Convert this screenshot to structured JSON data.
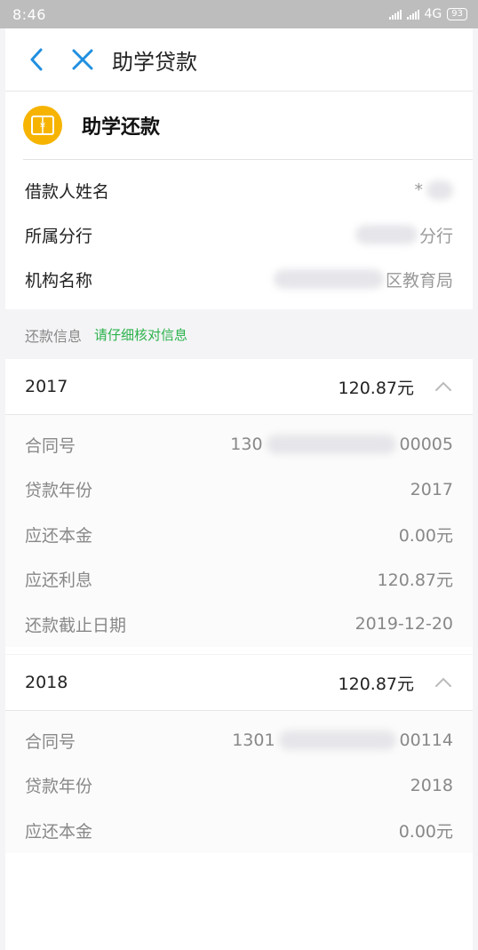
{
  "status": {
    "time": "8:46",
    "network": "4G",
    "battery": "93"
  },
  "nav": {
    "title": "助学贷款"
  },
  "header": {
    "title": "助学还款"
  },
  "borrower": [
    {
      "key": "借款人姓名",
      "value": "*"
    },
    {
      "key": "所属分行",
      "value": "分行"
    },
    {
      "key": "机构名称",
      "value": "区教育局"
    }
  ],
  "section": {
    "label": "还款信息",
    "hint": "请仔细核对信息"
  },
  "loans": [
    {
      "year": "2017",
      "amount": "120.87元",
      "rows": [
        {
          "key": "合同号",
          "value_prefix": "130",
          "value_suffix": "00005"
        },
        {
          "key": "贷款年份",
          "value": "2017"
        },
        {
          "key": "应还本金",
          "value": "0.00元"
        },
        {
          "key": "应还利息",
          "value": "120.87元"
        },
        {
          "key": "还款截止日期",
          "value": "2019-12-20"
        }
      ]
    },
    {
      "year": "2018",
      "amount": "120.87元",
      "rows": [
        {
          "key": "合同号",
          "value_prefix": "1301",
          "value_suffix": "00114"
        },
        {
          "key": "贷款年份",
          "value": "2018"
        },
        {
          "key": "应还本金",
          "value": "0.00元"
        }
      ]
    }
  ],
  "colors": {
    "accent_blue": "#1f8fe0",
    "brand_yellow": "#f6b400",
    "hint_green": "#2bb24c"
  }
}
